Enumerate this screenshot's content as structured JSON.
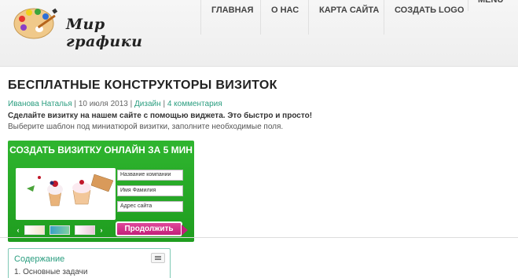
{
  "header": {
    "logo_text": "Мир графики",
    "nav": [
      "ГЛАВНАЯ",
      "О НАС",
      "КАРТА САЙТА",
      "СОЗДАТЬ LOGO",
      "MENU"
    ]
  },
  "post": {
    "title": "БЕСПЛАТНЫЕ КОНСТРУКТОРЫ ВИЗИТОК",
    "author": "Иванова Наталья",
    "date": "10 июля 2013",
    "category": "Дизайн",
    "comments": "4 комментария",
    "separator": "|",
    "lead": "Сделайте визитку на нашем сайте с помощью виджета. Это быстро и просто!",
    "description": "Выберите шаблон под миниатюрой визитки, заполните необходимые поля."
  },
  "widget": {
    "title": "СОЗДАТЬ ВИЗИТКУ ОНЛАЙН ЗА 5 МИН",
    "field_company": "Название компании",
    "field_name": "Имя Фамилия",
    "field_site": "Адрес сайта",
    "submit": "Продолжить",
    "prev_arrow": "‹",
    "next_arrow": "›"
  },
  "toc": {
    "title": "Содержание",
    "items": [
      "1. Основные задачи"
    ]
  },
  "colors": {
    "accent": "#2a9d7f",
    "widget_green": "#28aa28",
    "button_pink": "#d0338a"
  }
}
